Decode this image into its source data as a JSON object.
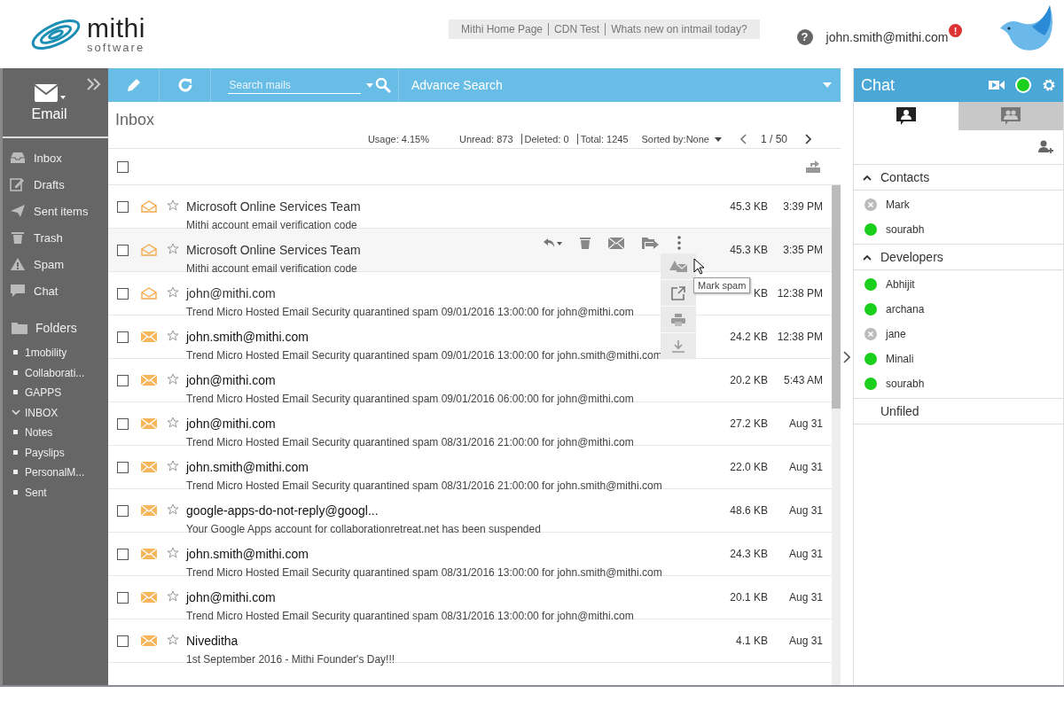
{
  "header": {
    "logo_name": "mithi",
    "logo_sub": "software",
    "links": [
      "Mithi Home Page",
      "CDN Test",
      "Whats new on intmail today?"
    ],
    "help": "?",
    "user": "john.smith@mithi.com",
    "alert": "!"
  },
  "sidebar": {
    "module": "Email",
    "nav": [
      {
        "label": "Inbox",
        "kind": "inbox"
      },
      {
        "label": "Drafts",
        "kind": "drafts"
      },
      {
        "label": "Sent items",
        "kind": "sent"
      },
      {
        "label": "Trash",
        "kind": "trash"
      },
      {
        "label": "Spam",
        "kind": "spam"
      },
      {
        "label": "Chat",
        "kind": "chat"
      }
    ],
    "folders_label": "Folders",
    "folders": [
      {
        "label": "1mobility",
        "kind": "leaf"
      },
      {
        "label": "Collaborati...",
        "kind": "leaf"
      },
      {
        "label": "GAPPS",
        "kind": "leaf"
      },
      {
        "label": "INBOX",
        "kind": "parent",
        "expanded": true
      },
      {
        "label": "Notes",
        "kind": "leaf"
      },
      {
        "label": "Payslips",
        "kind": "leaf"
      },
      {
        "label": "PersonalM...",
        "kind": "leaf"
      },
      {
        "label": "Sent",
        "kind": "leaf"
      }
    ]
  },
  "toolbar": {
    "search_placeholder": "Search mails",
    "advance": "Advance Search"
  },
  "list": {
    "title": "Inbox",
    "select_all_checked": false,
    "stats": [
      "Usage: 4.15%",
      "Unread: 873",
      "Deleted: 0",
      "Total: 1245"
    ],
    "sort": "Sorted by:None",
    "page": "1 / 50",
    "messages": [
      {
        "sender": "Microsoft Online Services Team",
        "subject": "Mithi account email verification code",
        "size": "45.3 KB",
        "time": "3:39 PM",
        "read": true,
        "checked": false,
        "starred": false,
        "hovered": false
      },
      {
        "sender": "Microsoft Online Services Team",
        "subject": "Mithi account email verification code",
        "size": "45.3 KB",
        "time": "3:35 PM",
        "read": true,
        "checked": false,
        "starred": false,
        "hovered": true
      },
      {
        "sender": "john@mithi.com",
        "subject": "Trend Micro Hosted Email Security quarantined spam 09/01/2016 13:00:00 for john@mithi.com",
        "size": "KB",
        "time": "12:38 PM",
        "read": true,
        "checked": false,
        "starred": false,
        "hovered": false
      },
      {
        "sender": "john.smith@mithi.com",
        "subject": "Trend Micro Hosted Email Security quarantined spam 09/01/2016 13:00:00 for john.smith@mithi.com",
        "size": "24.2 KB",
        "time": "12:38 PM",
        "read": false,
        "checked": false,
        "starred": false,
        "hovered": false
      },
      {
        "sender": "john@mithi.com",
        "subject": "Trend Micro Hosted Email Security quarantined spam 09/01/2016 06:00:00 for john@mithi.com",
        "size": "20.2 KB",
        "time": "5:43 AM",
        "read": false,
        "checked": false,
        "starred": false,
        "hovered": false
      },
      {
        "sender": "john@mithi.com",
        "subject": "Trend Micro Hosted Email Security quarantined spam 08/31/2016 21:00:00 for john@mithi.com",
        "size": "27.2 KB",
        "time": "Aug 31",
        "read": false,
        "checked": false,
        "starred": false,
        "hovered": false
      },
      {
        "sender": "john.smith@mithi.com",
        "subject": "Trend Micro Hosted Email Security quarantined spam 08/31/2016 21:00:00 for john.smith@mithi.com",
        "size": "22.0 KB",
        "time": "Aug 31",
        "read": false,
        "checked": false,
        "starred": false,
        "hovered": false
      },
      {
        "sender": "google-apps-do-not-reply@googl...",
        "subject": "Your Google Apps account for collaborationretreat.net has been suspended",
        "size": "48.6 KB",
        "time": "Aug 31",
        "read": false,
        "checked": false,
        "starred": false,
        "hovered": false
      },
      {
        "sender": "john.smith@mithi.com",
        "subject": "Trend Micro Hosted Email Security quarantined spam 08/31/2016 13:00:00 for john.smith@mithi.com",
        "size": "24.3 KB",
        "time": "Aug 31",
        "read": false,
        "checked": false,
        "starred": false,
        "hovered": false
      },
      {
        "sender": "john@mithi.com",
        "subject": "Trend Micro Hosted Email Security quarantined spam 08/31/2016 13:00:00 for john@mithi.com",
        "size": "20.1 KB",
        "time": "Aug 31",
        "read": false,
        "checked": false,
        "starred": false,
        "hovered": false
      },
      {
        "sender": "Niveditha",
        "subject": "1st September 2016 - Mithi Founder's Day!!!",
        "size": "4.1 KB",
        "time": "Aug 31",
        "read": false,
        "checked": false,
        "starred": false,
        "hovered": false
      }
    ]
  },
  "action_menu": {
    "tooltip": "Mark spam"
  },
  "chat": {
    "title": "Chat",
    "tabs": [
      {
        "kind": "contacts",
        "selected": true
      },
      {
        "kind": "groups",
        "selected": false
      }
    ],
    "groups": [
      {
        "name": "Contacts",
        "expanded": true,
        "contacts": [
          {
            "name": "Mark",
            "online": false
          },
          {
            "name": "sourabh",
            "online": true
          }
        ]
      },
      {
        "name": "Developers",
        "expanded": true,
        "contacts": [
          {
            "name": "Abhijit",
            "online": true
          },
          {
            "name": "archana",
            "online": true
          },
          {
            "name": "jane",
            "online": false
          },
          {
            "name": "Minali",
            "online": true
          },
          {
            "name": "sourabh",
            "online": true
          }
        ]
      },
      {
        "name": "Unfiled",
        "expanded": false
      }
    ]
  }
}
